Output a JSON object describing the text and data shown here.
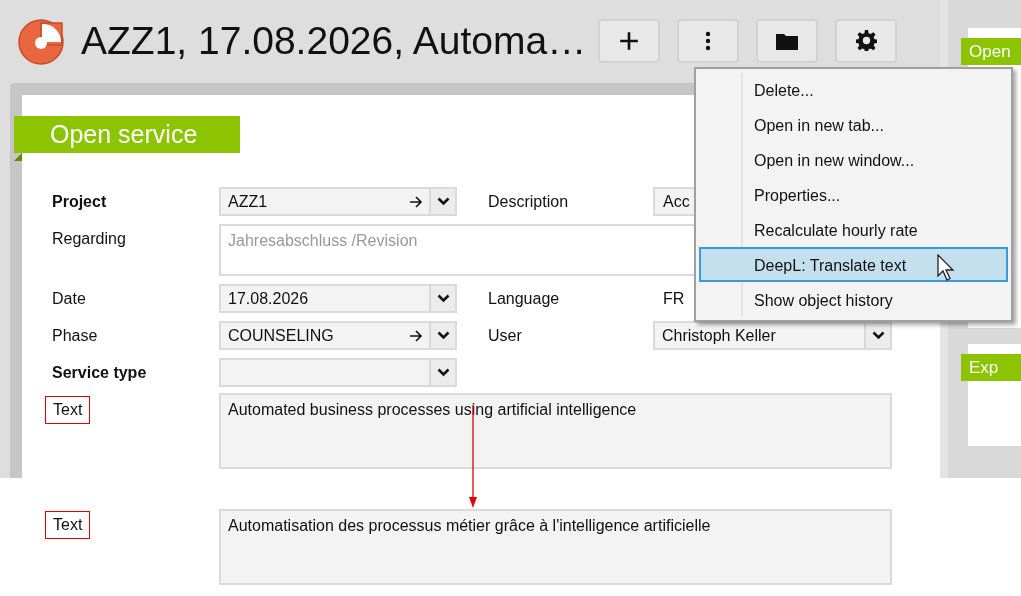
{
  "header": {
    "title": "AZZ1, 17.08.2026, Automa…",
    "buttons": [
      {
        "kind": "plus"
      },
      {
        "kind": "more"
      },
      {
        "kind": "folder"
      },
      {
        "kind": "settings"
      }
    ]
  },
  "section_title": "Open service",
  "form": {
    "rows": [
      {
        "label": "Project",
        "bold": true,
        "field": {
          "kind": "combo",
          "value": "AZZ1",
          "link": true
        },
        "side": {
          "label": "Description",
          "kind": "text",
          "value": "Acc"
        }
      },
      {
        "label": "Regarding",
        "bold": false,
        "field": {
          "kind": "area",
          "placeholder": "Jahresabschluss /Revision"
        }
      },
      {
        "label": "Date",
        "bold": false,
        "field": {
          "kind": "combo",
          "value": "17.08.2026",
          "link": false
        },
        "side": {
          "label": "Language",
          "kind": "plain",
          "value": "FR"
        }
      },
      {
        "label": "Phase",
        "bold": false,
        "field": {
          "kind": "combo",
          "value": "COUNSELING",
          "link": true
        },
        "side": {
          "label": "User",
          "kind": "combo",
          "value": "Christoph Keller"
        }
      },
      {
        "label": "Service type",
        "bold": true,
        "field": {
          "kind": "combo",
          "link": false
        }
      },
      {
        "label": "Text",
        "bold": false,
        "highlighted": true,
        "field": {
          "kind": "memo",
          "value": "Automated business processes using artificial intelligence"
        }
      }
    ]
  },
  "translation": {
    "label": "Text",
    "highlighted": true,
    "value": "Automatisation des processus métier grâce à l'intelligence artificielle"
  },
  "menu": {
    "items": [
      {
        "label": "Delete...",
        "selected": false
      },
      {
        "label": "Open in new tab...",
        "selected": false
      },
      {
        "label": "Open in new window...",
        "selected": false
      },
      {
        "label": "Properties...",
        "selected": false
      },
      {
        "label": "Recalculate hourly rate",
        "selected": false
      },
      {
        "label": "DeepL: Translate text",
        "selected": true
      },
      {
        "label": "Show object history",
        "selected": false
      }
    ]
  },
  "side_panel": {
    "tabs": [
      "Open",
      "Exp"
    ]
  }
}
